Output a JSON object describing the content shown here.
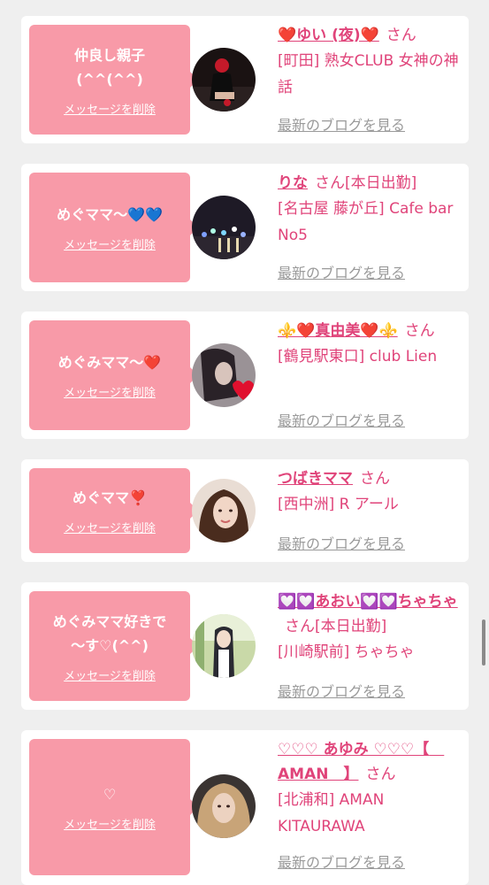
{
  "messages": [
    {
      "message": "仲良し親子\n(^^(^^)",
      "delete_label": "メッセージを削除",
      "cast_name": "❤️ゆい (夜)❤️",
      "honorific": "さん",
      "status": "",
      "shop": "[町田] 熟女CLUB 女神の神話",
      "blog_link": "最新のブログを見る",
      "avatar_icon": "cast-photo-dark-red"
    },
    {
      "message": "めぐママ〜💙💙",
      "delete_label": "メッセージを削除",
      "cast_name": "りな",
      "honorific": "さん",
      "status": "[本日出勤]",
      "shop": "[名古屋 藤が丘] Cafe bar No5",
      "blog_link": "最新のブログを見る",
      "avatar_icon": "cast-photo-bar-lights"
    },
    {
      "message": "めぐみママ〜❤️",
      "delete_label": "メッセージを削除",
      "cast_name": "⚜️❤️真由美❤️⚜️",
      "honorific": "さん",
      "status": "",
      "shop": "[鶴見駅東口] club Lien",
      "blog_link": "最新のブログを見る",
      "avatar_icon": "cast-photo-grey-heart"
    },
    {
      "message": "めぐママ❣️",
      "delete_label": "メッセージを削除",
      "cast_name": "つばきママ",
      "honorific": "さん",
      "status": "",
      "shop": "[西中洲] R アール",
      "blog_link": "最新のブログを見る",
      "avatar_icon": "cast-photo-portrait"
    },
    {
      "message": "めぐみママ好きで\n〜す♡(^^)",
      "delete_label": "メッセージを削除",
      "cast_name": "💟💟あおい💟💟ちゃちゃ",
      "honorific": "さん",
      "status": "[本日出勤]",
      "shop": "[川崎駅前] ちゃちゃ",
      "blog_link": "最新のブログを見る",
      "avatar_icon": "cast-photo-outdoor"
    },
    {
      "message": "♡",
      "delete_label": "メッセージを削除",
      "cast_name": "♡♡♡ あゆみ ♡♡♡【　AMAN　】",
      "honorific": "さん",
      "status": "",
      "shop": "[北浦和] AMAN KITAURAWA",
      "blog_link": "最新のブログを見る",
      "avatar_icon": "cast-photo-blonde"
    }
  ],
  "colors": {
    "bubble": "#f89aa8",
    "name": "#e0447a",
    "link": "#9a9a9a",
    "background": "#efefef"
  }
}
